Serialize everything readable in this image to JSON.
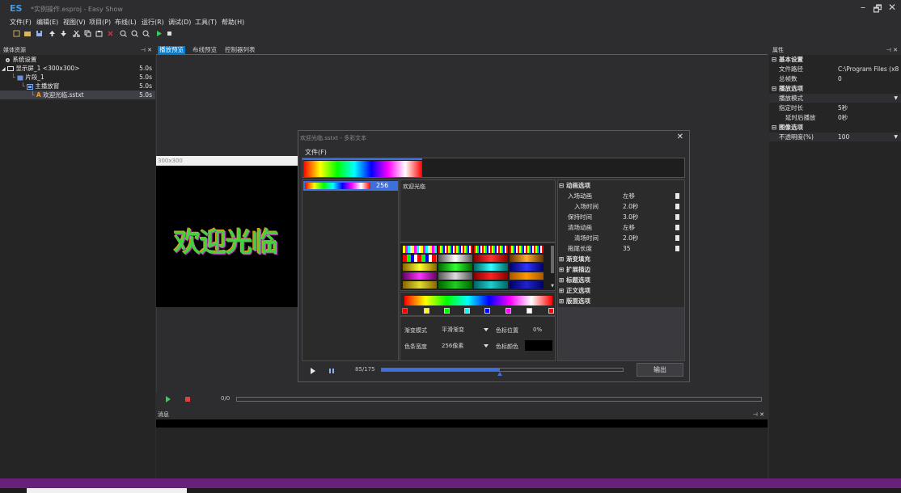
{
  "app": {
    "logo": "ES",
    "title": "*实例操作.esproj - Easy Show",
    "window_controls": [
      "–",
      "🗗",
      "✕"
    ]
  },
  "menus": [
    "文件(F)",
    "编辑(E)",
    "视图(V)",
    "项目(P)",
    "布线(L)",
    "运行(R)",
    "调试(D)",
    "工具(T)",
    "帮助(H)"
  ],
  "media_panel": {
    "title": "媒体资源",
    "pin": "⊣ ✕",
    "items": [
      {
        "label": "系统设置",
        "duration": ""
      },
      {
        "label": "显示屏_1 <300x300>",
        "duration": "5.0s"
      },
      {
        "label": "片段_1",
        "duration": "5.0s"
      },
      {
        "label": "主播放窗",
        "duration": "5.0s"
      },
      {
        "label": "欢迎光临.sstxt",
        "duration": "5.0s"
      }
    ]
  },
  "tabs": [
    "播放预览",
    "布线预览",
    "控制器列表"
  ],
  "preview": {
    "size_label": "300x300",
    "preview_text": "欢迎光临",
    "frame_counter": "0/0"
  },
  "messages_panel": {
    "title": "消息",
    "pin": "⊣ ✕"
  },
  "properties": {
    "title": "属性",
    "pin": "⊣ ✕",
    "rows": [
      {
        "type": "cat",
        "name": "基本设置"
      },
      {
        "type": "prop",
        "name": "文件路径",
        "value": "C:\\Program Files (x8"
      },
      {
        "type": "prop",
        "name": "总帧数",
        "value": "0"
      },
      {
        "type": "cat",
        "name": "播放选项"
      },
      {
        "type": "prop",
        "name": "播放模式",
        "value": "",
        "dropdown": true
      },
      {
        "type": "prop",
        "name": "指定时长",
        "value": "5秒"
      },
      {
        "type": "prop",
        "name": "延时后播放",
        "value": "0秒"
      },
      {
        "type": "cat",
        "name": "图像选项"
      },
      {
        "type": "prop",
        "name": "不透明度(%)",
        "value": "100",
        "dropdown": true
      }
    ]
  },
  "dialog": {
    "title": "欢迎光临.sstxt - 多彩文本",
    "close": "✕",
    "file_menu": "文件(F)",
    "gradient_count": "256",
    "text_value": "欢迎光临",
    "gradient_mode_label": "渐变模式",
    "gradient_mode_value": "平滑渐变",
    "color_pos_label": "色标位置",
    "color_pos_value": "0%",
    "bar_width_label": "色条宽度",
    "bar_width_value": "256像素",
    "color_stop_label": "色标颜色",
    "frame_counter": "85/175",
    "progress": 0.49,
    "export_button": "输出",
    "anim_section": "动画选项",
    "anim_rows": [
      {
        "name": "入场动画",
        "value": "左移"
      },
      {
        "name": "入场时间",
        "value": "2.0秒"
      },
      {
        "name": "保持时间",
        "value": "3.0秒"
      },
      {
        "name": "清场动画",
        "value": "左移"
      },
      {
        "name": "清场时间",
        "value": "2.0秒"
      },
      {
        "name": "拖尾长度",
        "value": "35"
      }
    ],
    "other_sections": [
      "渐变填充",
      "扩展描边",
      "标题选项",
      "正文选项",
      "版面选项"
    ]
  },
  "colors": {
    "accent": "#007acc",
    "progress_blue": "#3f6fd8",
    "status_bar": "#68217a"
  }
}
